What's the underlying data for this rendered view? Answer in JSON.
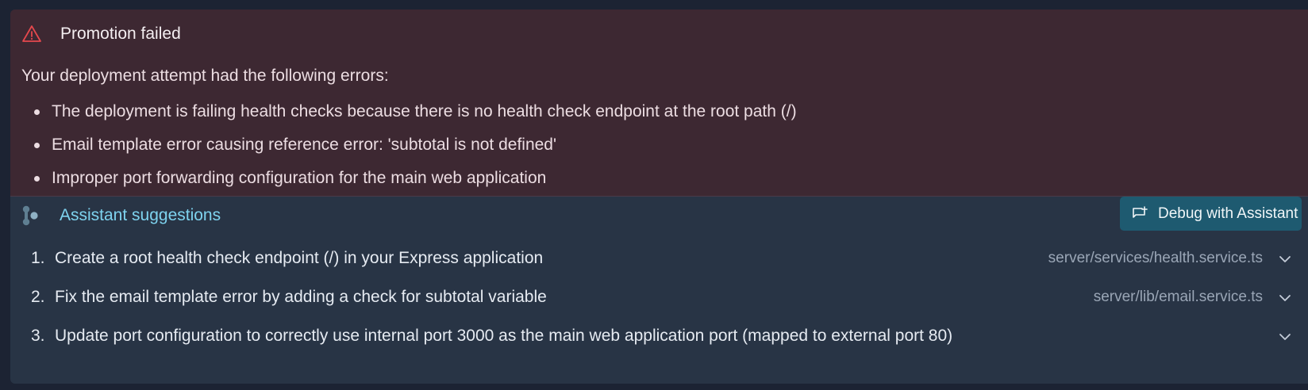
{
  "error": {
    "title": "Promotion failed",
    "intro": "Your deployment attempt had the following errors:",
    "items": [
      "The deployment is failing health checks because there is no health check endpoint at the root path (/)",
      "Email template error causing reference error: 'subtotal is not defined'",
      "Improper port forwarding configuration for the main web application"
    ],
    "icon": "warning-icon",
    "color": "#e5484d"
  },
  "assistant": {
    "title": "Assistant suggestions",
    "icon": "assistant-icon",
    "debug_button_label": "Debug with Assistant",
    "debug_button_icon": "chat-icon",
    "accent": "#7ed3ef",
    "suggestions": [
      {
        "number": "1.",
        "text": "Create a root health check endpoint (/) in your Express application",
        "file": "server/services/health.service.ts"
      },
      {
        "number": "2.",
        "text": "Fix the email template error by adding a check for subtotal variable",
        "file": "server/lib/email.service.ts"
      },
      {
        "number": "3.",
        "text": "Update port configuration to correctly use internal port 3000 as the main web application port (mapped to external port 80)",
        "file": ""
      }
    ]
  }
}
